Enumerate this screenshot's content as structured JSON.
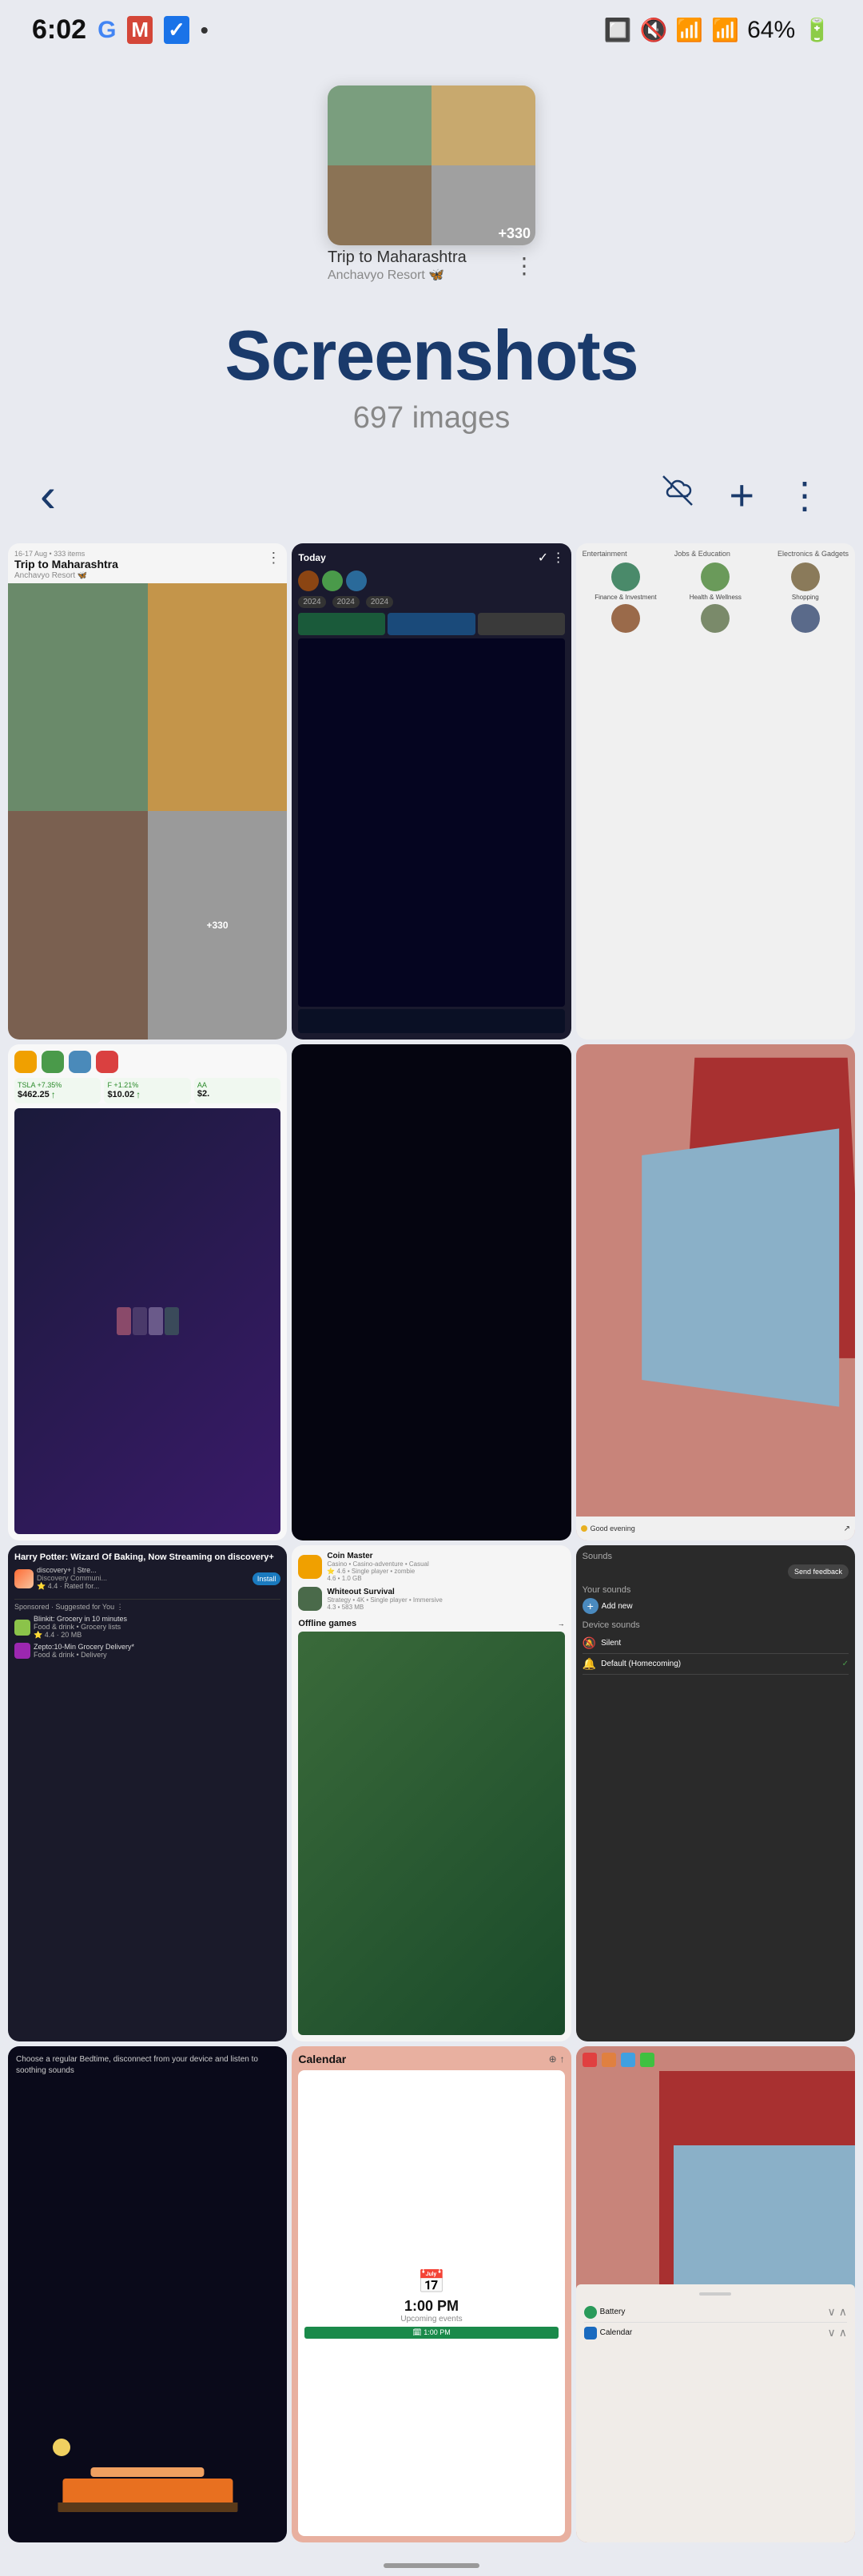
{
  "statusBar": {
    "time": "6:02",
    "battery": "64%",
    "icons": {
      "google": "G",
      "gmail": "M",
      "check": "✓",
      "dot": "•",
      "sim": "📶",
      "mute": "🔇",
      "wifi": "📶",
      "signal": "📶"
    }
  },
  "albumThumbnail": {
    "title": "Trip to Maharashtra",
    "subtitle": "Anchavyo Resort 🦋",
    "extraCount": "+330",
    "dotsLabel": "⋮"
  },
  "pageTitle": "Screenshots",
  "pageSubtitle": "697 images",
  "toolbar": {
    "back": "‹",
    "cloudOff": "☁",
    "add": "+",
    "more": "⋮"
  },
  "screenshots": [
    {
      "id": "trip-to-maharashtra",
      "type": "trip",
      "title": "Trip to Maharashtra",
      "subtitle": "Anchavyo Resort 🦋",
      "dateRange": "16-17 Aug • 333 items",
      "extra": "+330",
      "dots": "⋮"
    },
    {
      "id": "today-circles",
      "type": "today",
      "title": "Today",
      "years": [
        "2024",
        "2024",
        "2024"
      ]
    },
    {
      "id": "entertainment",
      "type": "entertainment",
      "categories": [
        "Entertainment",
        "Jobs & Education",
        "Electronics & Gadgets",
        "Finance & Investment",
        "Health & Wellness",
        "Shopping"
      ]
    },
    {
      "id": "finance-widgets",
      "type": "finance",
      "stocks": [
        {
          "label": "TSLA +7.35%",
          "value": "$462.25"
        },
        {
          "label": "F +1.21%",
          "value": "$10.02"
        }
      ]
    },
    {
      "id": "dark-screen",
      "type": "dark"
    },
    {
      "id": "geometric-pink",
      "type": "geometric",
      "bottomText": "Good evening",
      "dotColor": "#e8b020"
    },
    {
      "id": "harry-potter",
      "type": "hp",
      "title": "Harry Potter: Wizard Of Baking, Now Streaming on discovery+",
      "appName": "discovery+ | Stre...",
      "appSub": "Discovery Communi...",
      "rating": "4.4",
      "installBtn": "Install",
      "sponsored": "Sponsored · Suggested for You",
      "items": [
        {
          "name": "Blinkit: Grocery in 10 minutes",
          "sub": "Food & drink • Grocery lists",
          "rating": "4.4",
          "size": "20 MB",
          "color": "#8BC34A"
        },
        {
          "name": "Zepto:10-Min Grocery Delivery*",
          "sub": "Food & drink • Delivery",
          "color": "#9C27B0"
        }
      ]
    },
    {
      "id": "offline-games",
      "type": "games",
      "games": [
        {
          "name": "Coin Master",
          "sub": "Casino • Casino-adventure • Casual",
          "rating": "4.6",
          "size": "1.0 GB"
        },
        {
          "name": "Whiteout Survival",
          "sub": "Strategy • 4K • Single player • Immersive",
          "rating": "4.3",
          "size": "583 MB"
        }
      ],
      "offlineLabel": "Offline games"
    },
    {
      "id": "sounds",
      "type": "sounds",
      "feedbackBtn": "Send feedback",
      "yourSoundsLabel": "Your sounds",
      "addNewLabel": "Add new",
      "deviceSoundsLabel": "Device sounds",
      "items": [
        {
          "name": "Silent",
          "checked": false
        },
        {
          "name": "Default (Homecoming)",
          "checked": true
        }
      ]
    },
    {
      "id": "bedtime",
      "type": "bedtime",
      "text": "Choose a regular Bedtime, disconnect from your device and listen to soothing sounds"
    },
    {
      "id": "calendar",
      "type": "calendar",
      "title": "Calendar",
      "time": "1:00 PM",
      "upcomingLabel": "Upcoming events",
      "eventLabel": "🗓 1:00 PM"
    },
    {
      "id": "geometric-battery",
      "type": "geo-battery",
      "items": [
        {
          "label": "Battery",
          "icon": "battery"
        },
        {
          "label": "Calendar",
          "icon": "calendar"
        }
      ]
    }
  ]
}
